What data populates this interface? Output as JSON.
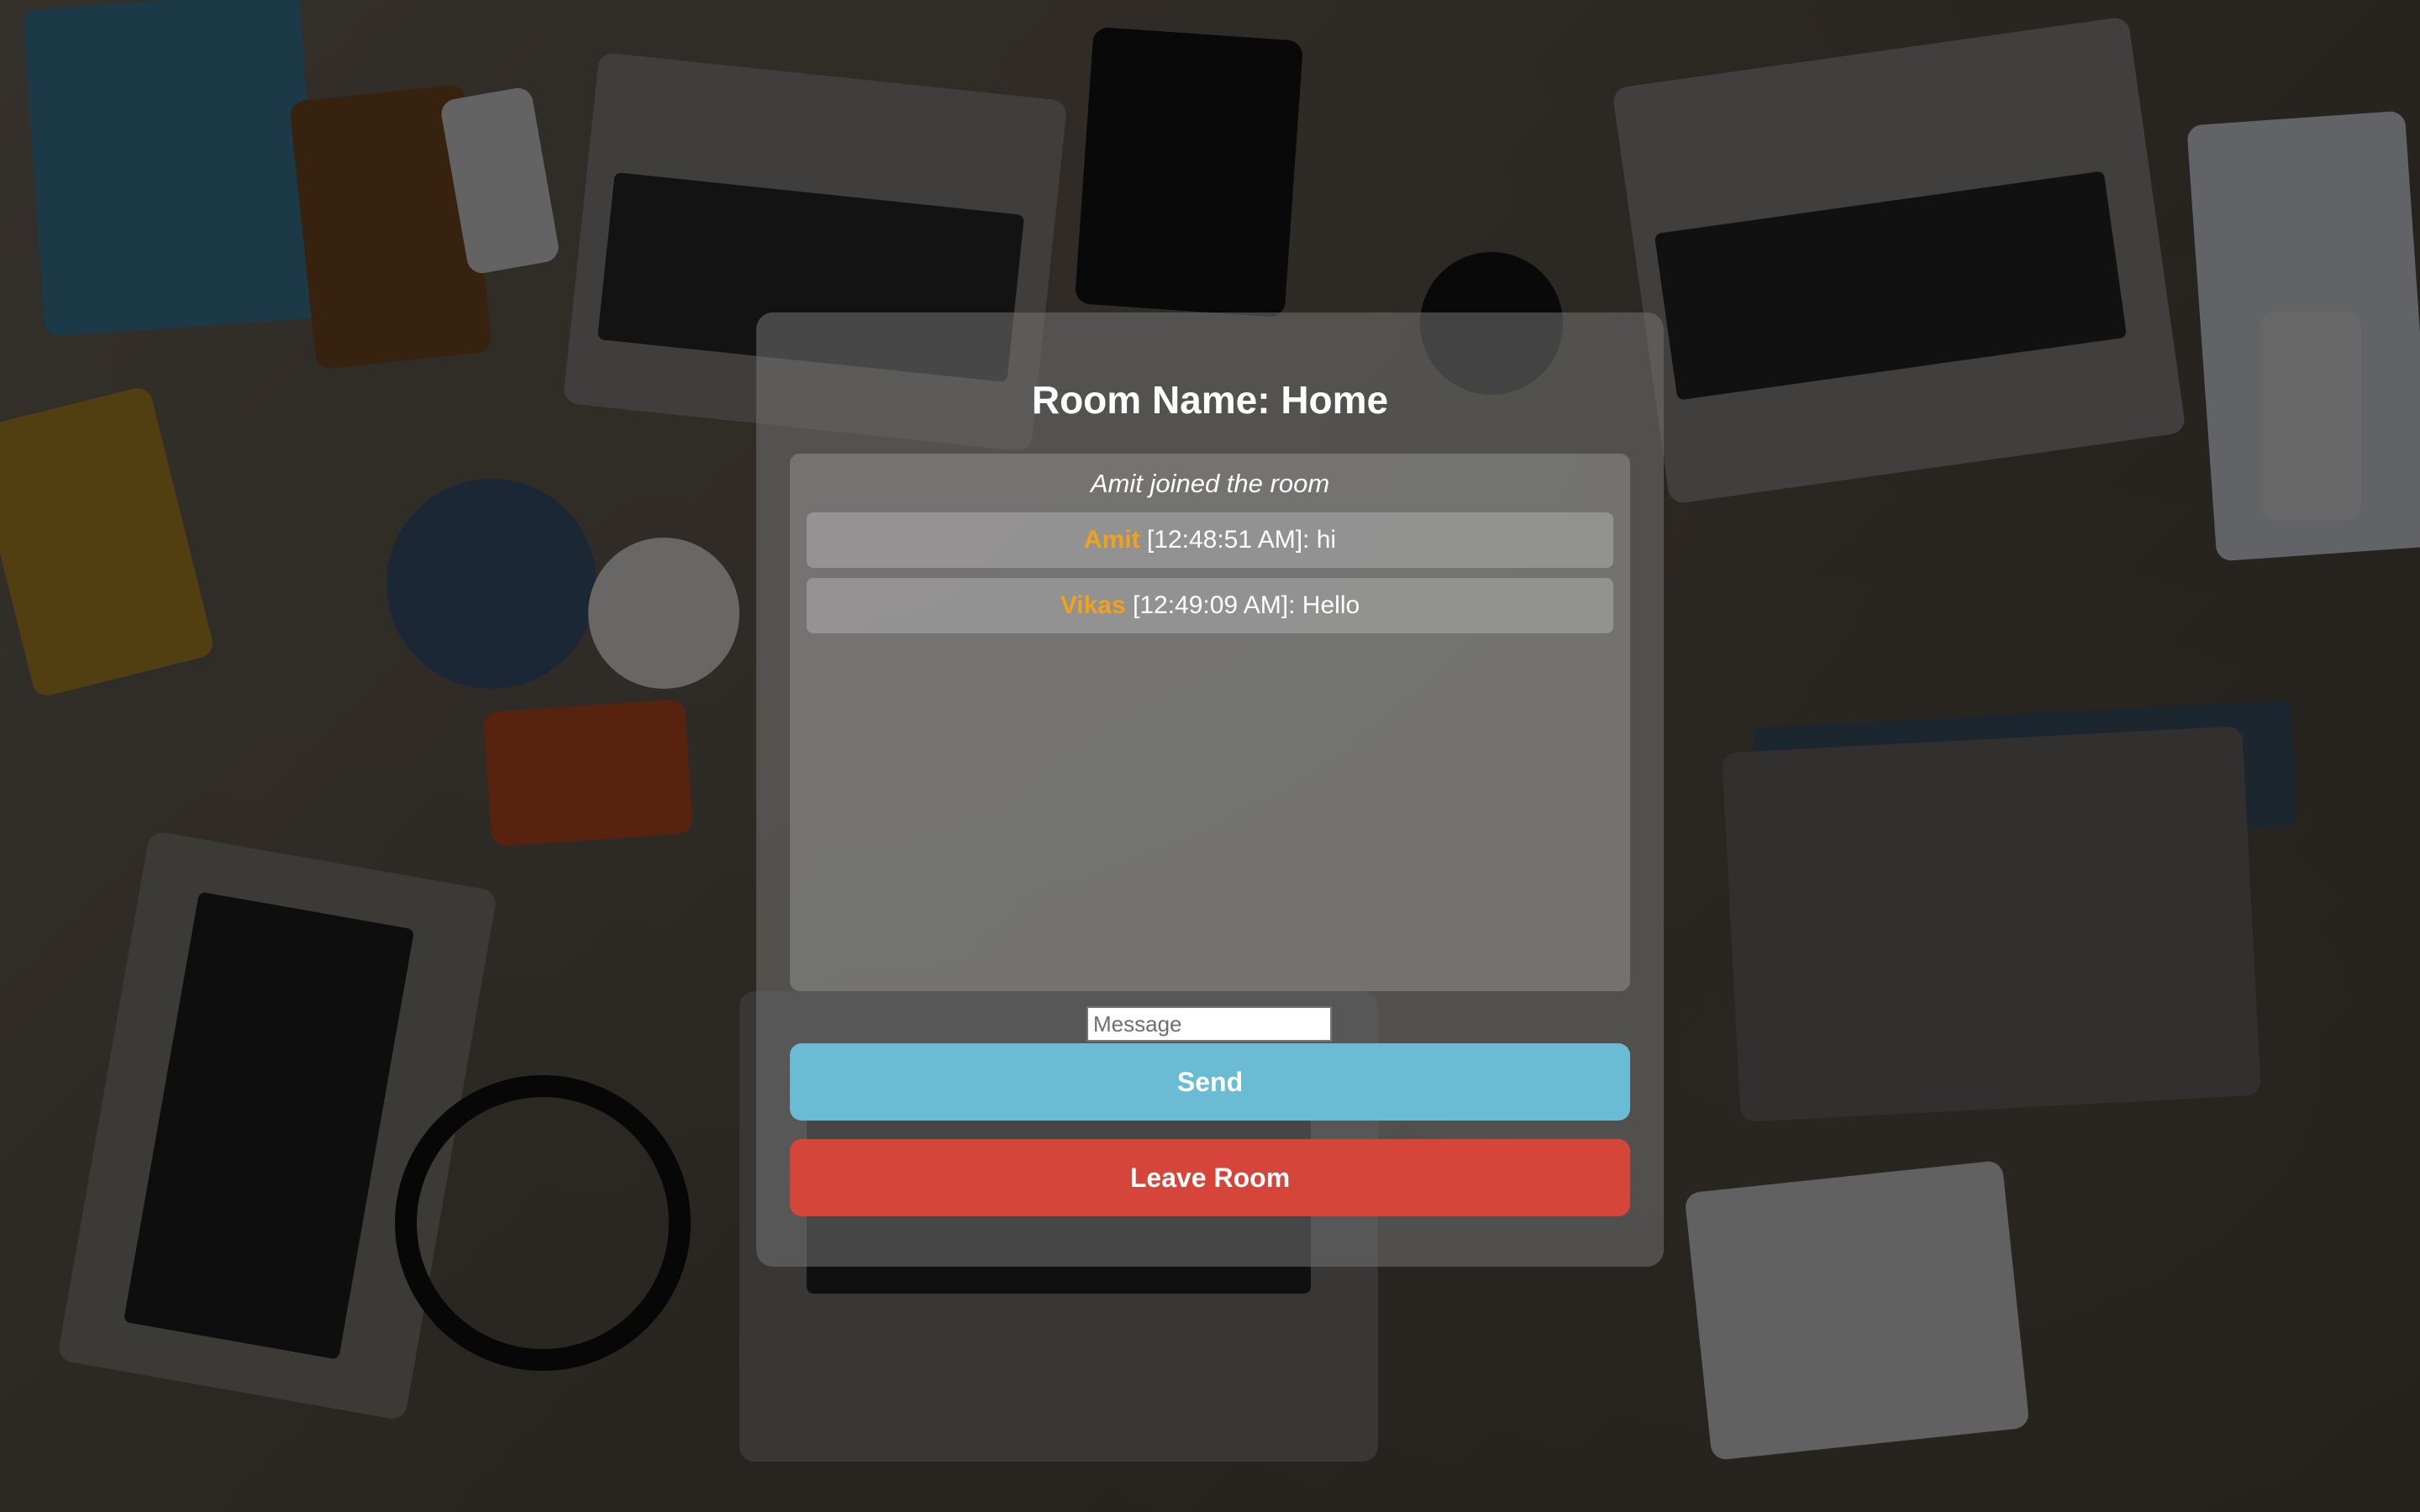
{
  "room": {
    "title": "Room Name: Home"
  },
  "messages": {
    "system": "Amit joined the room",
    "items": [
      {
        "author": "Amit",
        "text": " [12:48:51 AM]: hi"
      },
      {
        "author": "Vikas",
        "text": " [12:49:09 AM]: Hello"
      }
    ]
  },
  "composer": {
    "placeholder": "Message",
    "send_label": "Send",
    "leave_label": "Leave Room"
  },
  "colors": {
    "author_name": "#f0a21a",
    "send_button": "#69bcd4",
    "leave_button": "#d6453a"
  }
}
